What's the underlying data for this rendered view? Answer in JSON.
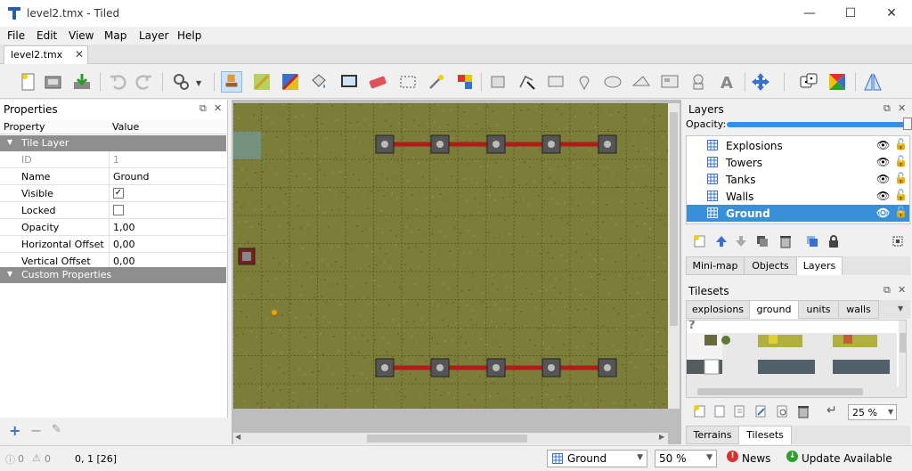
{
  "window": {
    "title": "level2.tmx - Tiled",
    "minimize": "—",
    "maximize": "☐",
    "close": "✕"
  },
  "menu": {
    "items": [
      "File",
      "Edit",
      "View",
      "Map",
      "Layer",
      "Help"
    ]
  },
  "doc_tabs": [
    {
      "label": "level2.tmx",
      "close": "✕"
    }
  ],
  "properties_panel": {
    "title": "Properties",
    "columns": [
      "Property",
      "Value"
    ],
    "groups": {
      "tile_layer": "Tile Layer",
      "custom": "Custom Properties"
    },
    "rows": [
      {
        "name": "ID",
        "value": "1",
        "disabled": true
      },
      {
        "name": "Name",
        "value": "Ground"
      },
      {
        "name": "Visible",
        "value": "✓",
        "checkbox": true,
        "checked": true
      },
      {
        "name": "Locked",
        "value": "",
        "checkbox": true,
        "checked": false
      },
      {
        "name": "Opacity",
        "value": "1,00"
      },
      {
        "name": "Horizontal Offset",
        "value": "0,00"
      },
      {
        "name": "Vertical Offset",
        "value": "0,00"
      }
    ]
  },
  "layers_panel": {
    "title": "Layers",
    "opacity_label": "Opacity:",
    "opacity": 1.0,
    "layers": [
      {
        "name": "Explosions",
        "selected": false
      },
      {
        "name": "Towers",
        "selected": false
      },
      {
        "name": "Tanks",
        "selected": false
      },
      {
        "name": "Walls",
        "selected": false
      },
      {
        "name": "Ground",
        "selected": true
      }
    ],
    "tabs": [
      "Mini-map",
      "Objects",
      "Layers"
    ],
    "active_tab": "Layers"
  },
  "tilesets_panel": {
    "title": "Tilesets",
    "tabs": [
      "explosions",
      "ground",
      "units",
      "walls"
    ],
    "active_tab": "ground",
    "zoom": "25 %",
    "bottom_tabs": [
      "Terrains",
      "Tilesets"
    ],
    "active_bottom_tab": "Tilesets"
  },
  "statusbar": {
    "errors": "0",
    "warnings": "0",
    "coords": "0, 1 [26]",
    "layer_combo": "Ground",
    "zoom_combo": "50 %",
    "news": "News",
    "update": "Update Available"
  },
  "colors": {
    "accent": "#3a8fd9",
    "ground": "#7d7d3a",
    "wall": "#b01c1c"
  }
}
